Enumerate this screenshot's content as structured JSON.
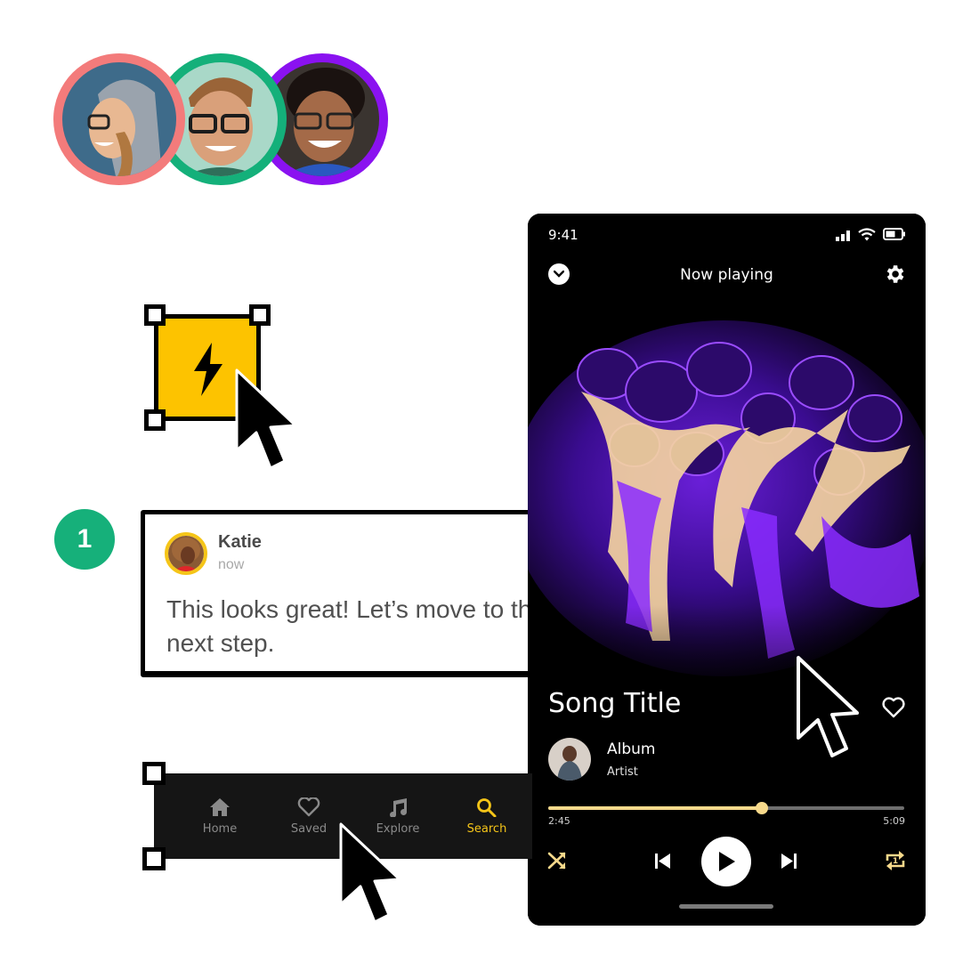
{
  "collaborators": [
    {
      "name": "avatar-hoodie-woman",
      "ring_color": "#f37b7b",
      "photo_bg": "#3e6b8a",
      "skin": "#e8b892"
    },
    {
      "name": "avatar-glasses-man",
      "ring_color": "#14b07a",
      "photo_bg": "#a9d8c8",
      "skin": "#d9a07a"
    },
    {
      "name": "avatar-curly-woman",
      "ring_color": "#8a12f0",
      "photo_bg": "#3a3430",
      "skin": "#a46a48"
    }
  ],
  "component": {
    "icon": "lightning-bolt-icon",
    "fill": "#fdc300"
  },
  "step": {
    "number": "1",
    "color": "#16b07a"
  },
  "comment": {
    "author": "Katie",
    "time": "now",
    "text": "This looks great! Let’s move to the next step.",
    "avatar_ring": "#f5c518"
  },
  "nav": {
    "items": [
      {
        "label": "Home",
        "icon": "home-icon",
        "active": false
      },
      {
        "label": "Saved",
        "icon": "heart-outline-icon",
        "active": false
      },
      {
        "label": "Explore",
        "icon": "music-note-icon",
        "active": false
      },
      {
        "label": "Search",
        "icon": "search-icon",
        "active": true
      }
    ],
    "active_color": "#f5c518"
  },
  "player": {
    "status_time": "9:41",
    "header_title": "Now playing",
    "song_title": "Song Title",
    "album": "Album",
    "artist": "Artist",
    "elapsed": "2:45",
    "duration": "5:09",
    "progress_fraction": 0.6,
    "accent": "#f7d98b"
  }
}
